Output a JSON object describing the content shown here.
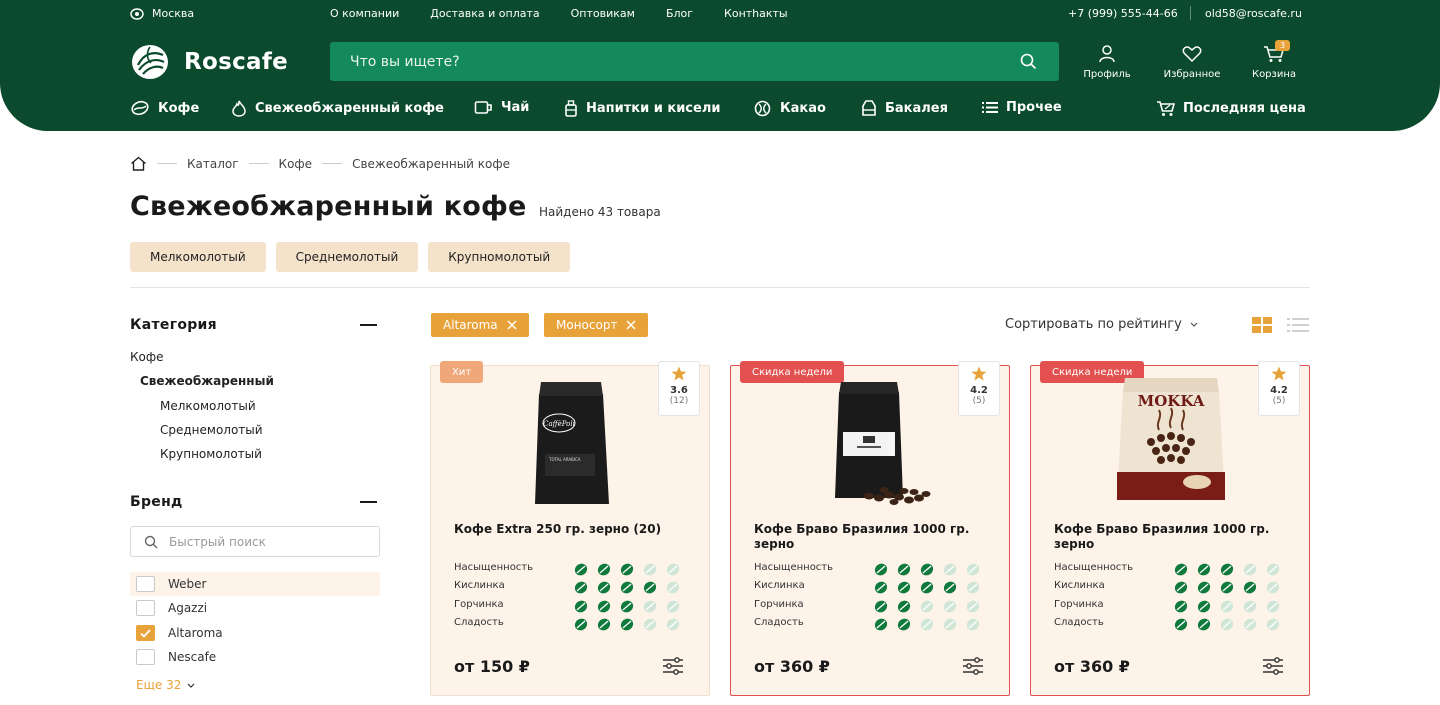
{
  "topbar": {
    "city": "Москва",
    "links": [
      "О компании",
      "Доставка и оплата",
      "Оптовикам",
      "Блог",
      "Контhакты"
    ],
    "phone": "+7 (999) 555-44-66",
    "email": "old58@roscafe.ru"
  },
  "header": {
    "logo_text": "Roscafe",
    "search_placeholder": "Что вы ищете?",
    "profile_label": "Профиль",
    "favorites_label": "Избранное",
    "cart_label": "Корзина",
    "cart_count": "3"
  },
  "menu": [
    {
      "label": "Кофе",
      "icon": "coffee-bean-icon"
    },
    {
      "label": "Свежеобжаренный кофе",
      "icon": "flame-icon"
    },
    {
      "label": "Чай",
      "icon": "tea-cup-icon"
    },
    {
      "label": "Напитки и кисели",
      "icon": "bottle-icon"
    },
    {
      "label": "Какао",
      "icon": "cocoa-icon"
    },
    {
      "label": "Бакалея",
      "icon": "grocery-icon"
    },
    {
      "label": "Прочее",
      "icon": "list-icon"
    },
    {
      "label": "Последняя цена",
      "icon": "cart-percent-icon"
    }
  ],
  "breadcrumbs": [
    "Каталог",
    "Кофе",
    "Свежеобжаренный кофе"
  ],
  "page": {
    "title": "Свежеобжаренный кофе",
    "found": "Найдено 43 товара",
    "grind_chips": [
      "Мелкомолотый",
      "Среднемолотый",
      "Крупномолотый"
    ]
  },
  "sidebar": {
    "category_title": "Категория",
    "categories": [
      {
        "label": "Кофе",
        "level": 0
      },
      {
        "label": "Свежеобжаренный",
        "level": 1
      },
      {
        "label": "Мелкомолотый",
        "level": 2
      },
      {
        "label": "Среднемолотый",
        "level": 2
      },
      {
        "label": "Крупномолотый",
        "level": 2
      }
    ],
    "brand_title": "Бренд",
    "brand_search_placeholder": "Быстрый поиск",
    "brands": [
      {
        "label": "Weber",
        "checked": false
      },
      {
        "label": "Agazzi",
        "checked": false
      },
      {
        "label": "Altaroma",
        "checked": true
      },
      {
        "label": "Nescafe",
        "checked": false
      }
    ],
    "more_label": "Еще 32"
  },
  "active_filters": [
    "Altaroma",
    "Моносорт"
  ],
  "sort_label": "Сортировать по рейтингу",
  "attribute_names": [
    "Насыщенность",
    "Кислинка",
    "Горчинка",
    "Сладость"
  ],
  "products": [
    {
      "tag": "Хит",
      "tag_color": "#f0a77a",
      "rating": "3.6",
      "reviews": "(12)",
      "name": "Кофе Extra 250 гр. зерно (20)",
      "levels": [
        3,
        4,
        3,
        3
      ],
      "price": "от 150 ₽",
      "package_brand": "CaffèPoli",
      "package_text": "TOTAL ARABICA"
    },
    {
      "tag": "Скидка недели",
      "tag_color": "#e25050",
      "rating": "4.2",
      "reviews": "(5)",
      "name": "Кофе Браво Бразилия 1000 гр. зерно",
      "levels": [
        3,
        4,
        2,
        2
      ],
      "price": "от 360 ₽"
    },
    {
      "tag": "Скидка недели",
      "tag_color": "#e25050",
      "rating": "4.2",
      "reviews": "(5)",
      "name": "Кофе Браво Бразилия 1000 гр. зерно",
      "levels": [
        3,
        4,
        2,
        2
      ],
      "price": "от 360 ₽",
      "package_brand": "MOKKA"
    }
  ],
  "colors": {
    "header_green": "#0b4a2c",
    "search_green": "#148a5c",
    "accent_orange": "#e8a23a",
    "bean_on": "#0f7a3c",
    "bean_off": "#cfe6d6",
    "card_bg": "#fdf3e9"
  }
}
